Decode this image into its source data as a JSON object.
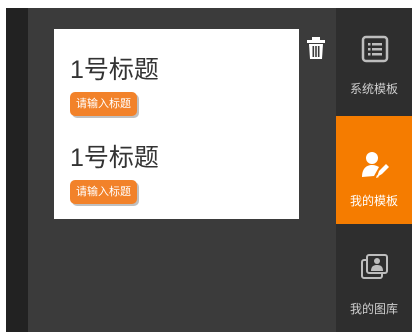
{
  "editor": {
    "blocks": [
      {
        "heading": "1号标题",
        "button_label": "请输入标题"
      },
      {
        "heading": "1号标题",
        "button_label": "请输入标题"
      }
    ],
    "delete_icon": "trash-icon"
  },
  "sidebar": {
    "items": [
      {
        "label": "系统模板",
        "icon": "template-list-icon",
        "active": false
      },
      {
        "label": "我的模板",
        "icon": "user-edit-icon",
        "active": true
      },
      {
        "label": "我的图库",
        "icon": "gallery-icon",
        "active": false
      }
    ]
  },
  "colors": {
    "accent": "#f57c00",
    "pill": "#f2822a",
    "canvas_bg": "#3b3b3b",
    "sidebar_bg": "#2e2e2e",
    "dark_strip": "#222222"
  }
}
